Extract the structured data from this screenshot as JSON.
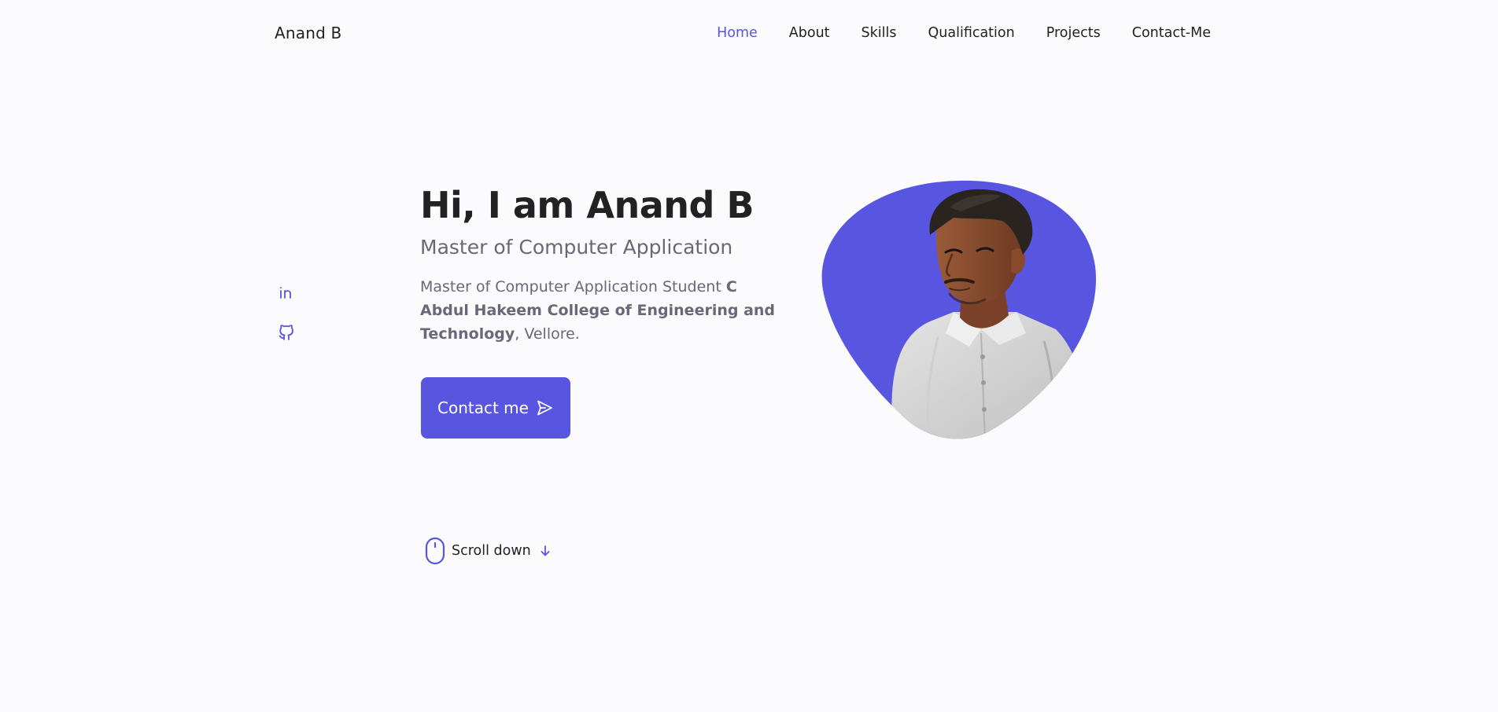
{
  "header": {
    "logo": "Anand B",
    "nav": [
      {
        "label": "Home",
        "active": true
      },
      {
        "label": "About",
        "active": false
      },
      {
        "label": "Skills",
        "active": false
      },
      {
        "label": "Qualification",
        "active": false
      },
      {
        "label": "Projects",
        "active": false
      },
      {
        "label": "Contact-Me",
        "active": false
      }
    ]
  },
  "social": {
    "items": [
      {
        "icon": "linkedin-icon"
      },
      {
        "icon": "github-icon"
      }
    ]
  },
  "hero": {
    "title": "Hi, I am Anand B",
    "subtitle": "Master of Computer Application",
    "description": {
      "prefix": "Master of Computer Application Student ",
      "college": "C Abdul Hakeem College of Engineering and Technology",
      "suffix": ", Vellore."
    },
    "button": {
      "label": "Contact me",
      "icon": "send-icon"
    },
    "image": {
      "alt": "Profile photo",
      "blob_color": "#5856e0"
    }
  },
  "scroll": {
    "label": "Scroll down",
    "icon": "mouse-icon",
    "arrow_icon": "arrow-down-icon"
  },
  "colors": {
    "accent": "#5856e0",
    "background": "#fbfafd",
    "text": "#222222",
    "muted": "#696878"
  }
}
